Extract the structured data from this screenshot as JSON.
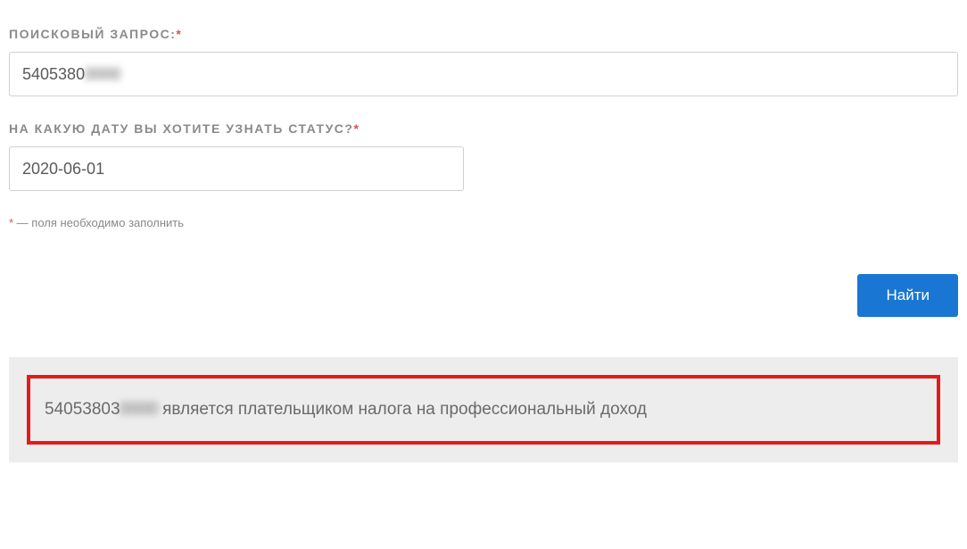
{
  "search": {
    "label": "ПОИСКОВЫЙ ЗАПРОС:",
    "value_prefix": "5405380",
    "value_hidden": "0000"
  },
  "date": {
    "label": "НА КАКУЮ ДАТУ ВЫ ХОТИТЕ УЗНАТЬ СТАТУС?",
    "value": "2020-06-01"
  },
  "required_marker": "*",
  "note_text": " — поля необходимо заполнить",
  "button": {
    "search_label": "Найти"
  },
  "result": {
    "id_prefix": "54053803",
    "id_hidden": "0000",
    "message": " является плательщиком налога на профессиональный доход"
  }
}
